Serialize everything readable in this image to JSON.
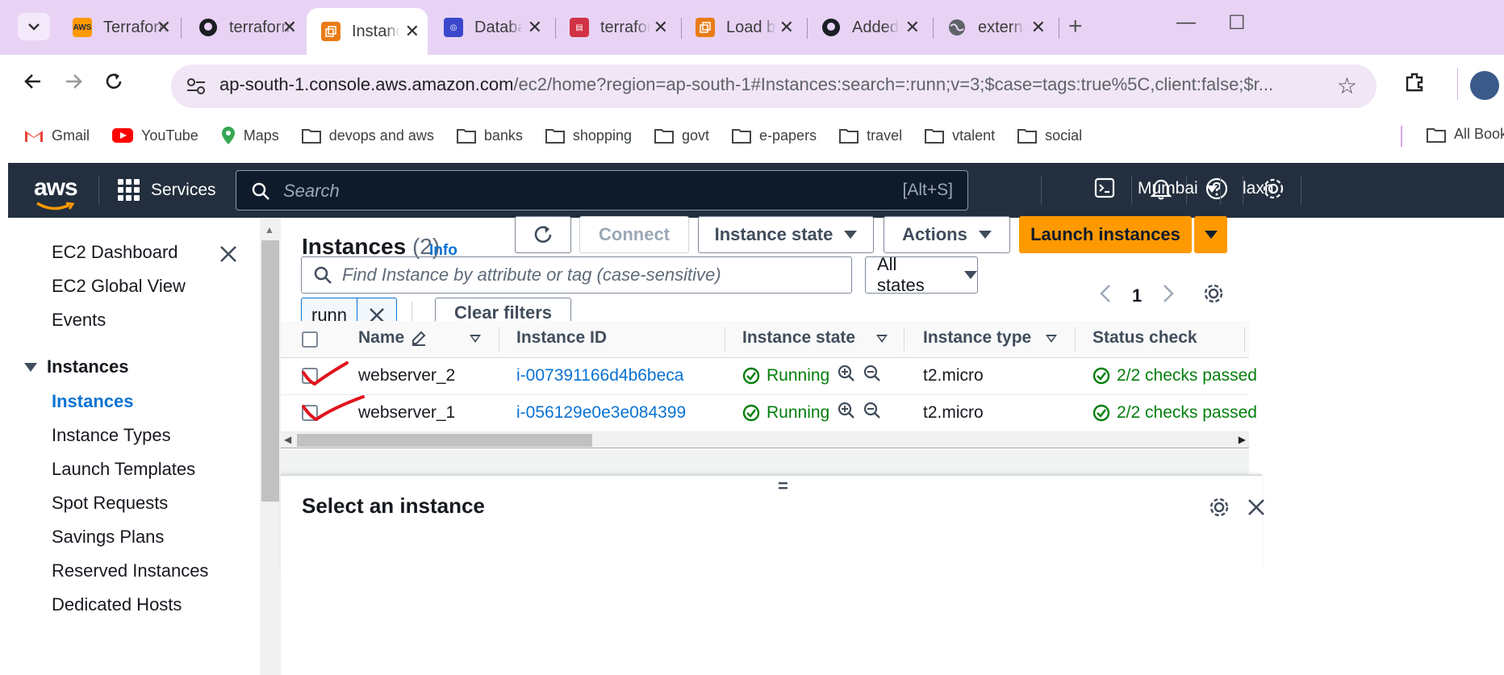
{
  "browser": {
    "tabs": [
      {
        "title": "Terraform",
        "favicon": "aws-icon",
        "active": false
      },
      {
        "title": "terraform",
        "favicon": "github-icon",
        "active": false
      },
      {
        "title": "Instances",
        "favicon": "ec2-icon",
        "active": true
      },
      {
        "title": "Database",
        "favicon": "rds-icon",
        "active": false
      },
      {
        "title": "terraform",
        "favicon": "id-card-icon",
        "active": false
      },
      {
        "title": "Load balancers",
        "favicon": "ec2-icon",
        "active": false
      },
      {
        "title": "Added c",
        "favicon": "github-icon",
        "active": false
      },
      {
        "title": "external",
        "favicon": "globe-icon",
        "active": false
      }
    ],
    "url_host": "ap-south-1.console.aws.amazon.com",
    "url_path": "/ec2/home?region=ap-south-1#Instances:search=:runn;v=3;$case=tags:true%5C,client:false;$r...",
    "bookmarks": [
      "Gmail",
      "YouTube",
      "Maps",
      "devops and aws",
      "banks",
      "shopping",
      "govt",
      "e-papers",
      "travel",
      "vtalent",
      "social"
    ],
    "all_bookmarks": "All Book"
  },
  "aws_nav": {
    "logo": "aws",
    "services": "Services",
    "search_placeholder": "Search",
    "search_shortcut": "[Alt+S]",
    "region": "Mumbai",
    "user": "laxn"
  },
  "sidebar": {
    "items": [
      "EC2 Dashboard",
      "EC2 Global View",
      "Events"
    ],
    "section": "Instances",
    "section_items": [
      "Instances",
      "Instance Types",
      "Launch Templates",
      "Spot Requests",
      "Savings Plans",
      "Reserved Instances",
      "Dedicated Hosts"
    ],
    "active_item": "Instances"
  },
  "main": {
    "title": "Instances",
    "count": "(2)",
    "info": "Info",
    "connect": "Connect",
    "instance_state": "Instance state",
    "actions": "Actions",
    "launch": "Launch instances",
    "find_placeholder": "Find Instance by attribute or tag (case-sensitive)",
    "states_filter": "All states",
    "filter_token": "runn",
    "clear_filters": "Clear filters",
    "page": "1",
    "columns": [
      "Name",
      "Instance ID",
      "Instance state",
      "Instance type",
      "Status check"
    ],
    "rows": [
      {
        "name": "webserver_2",
        "id": "i-007391166d4b6beca",
        "state": "Running",
        "type": "t2.micro",
        "status": "2/2 checks passed"
      },
      {
        "name": "webserver_1",
        "id": "i-056129e0e3e084399",
        "state": "Running",
        "type": "t2.micro",
        "status": "2/2 checks passed"
      }
    ],
    "split_handle": "=",
    "split_title": "Select an instance"
  },
  "colors": {
    "tabbar": "#e8d3f5",
    "aws_nav": "#232f3e",
    "link": "#0972d3",
    "primary": "#ff9900",
    "success": "#037f0c",
    "annotation": "#e0141e"
  }
}
